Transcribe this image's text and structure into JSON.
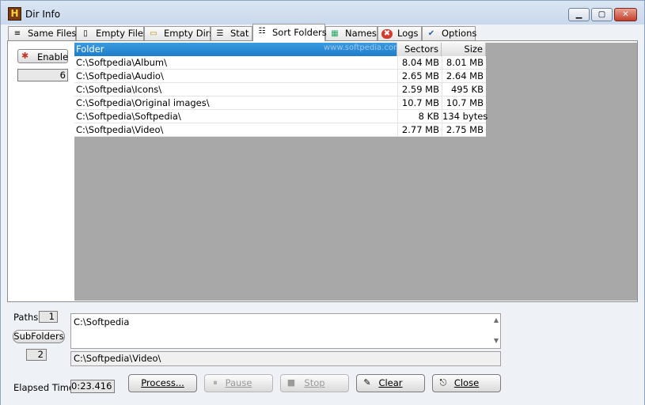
{
  "window": {
    "title": "Dir Info",
    "icon_glyph": "H"
  },
  "tabs": [
    {
      "label": "Same Files",
      "icon": "same-files-icon",
      "glyph": "≡"
    },
    {
      "label": "Empty Files",
      "icon": "empty-files-icon",
      "glyph": "▯"
    },
    {
      "label": "Empty Dirs",
      "icon": "empty-folder-icon",
      "glyph": "▭"
    },
    {
      "label": "Stat",
      "icon": "stat-icon",
      "glyph": "☰"
    },
    {
      "label": "Sort Folders",
      "icon": "sort-list-icon",
      "glyph": "☷",
      "active": true
    },
    {
      "label": "Names",
      "icon": "names-icon",
      "glyph": "▦"
    },
    {
      "label": "Logs",
      "icon": "logs-icon",
      "glyph": "✖"
    },
    {
      "label": "Options",
      "icon": "options-icon",
      "glyph": "✔"
    }
  ],
  "left": {
    "enable_label": "Enable",
    "count": "6"
  },
  "grid": {
    "watermark": "www.softpedia.com",
    "headers": {
      "folder": "Folder",
      "sectors": "Sectors",
      "size": "Size"
    },
    "rows": [
      {
        "folder": "C:\\Softpedia\\Album\\",
        "sectors": "8.04 MB",
        "size": "8.01 MB"
      },
      {
        "folder": "C:\\Softpedia\\Audio\\",
        "sectors": "2.65 MB",
        "size": "2.64 MB"
      },
      {
        "folder": "C:\\Softpedia\\Icons\\",
        "sectors": "2.59 MB",
        "size": "495 KB"
      },
      {
        "folder": "C:\\Softpedia\\Original images\\",
        "sectors": "10.7 MB",
        "size": "10.7 MB"
      },
      {
        "folder": "C:\\Softpedia\\Softpedia\\",
        "sectors": "8 KB",
        "size": "134 bytes"
      },
      {
        "folder": "C:\\Softpedia\\Video\\",
        "sectors": "2.77 MB",
        "size": "2.75 MB"
      }
    ]
  },
  "bottom": {
    "paths_label": "Paths",
    "paths_count": "1",
    "subfolders_label": "SubFolders",
    "subfolders_count": "2",
    "paths_text": "C:\\Softpedia",
    "status_text": "C:\\Softpedia\\Video\\",
    "elapsed_label": "Elapsed Time",
    "elapsed_value": "0:23.416"
  },
  "buttons": {
    "process": "Process...",
    "pause": "Pause",
    "stop": "Stop",
    "clear": "Clear",
    "close": "Close"
  }
}
